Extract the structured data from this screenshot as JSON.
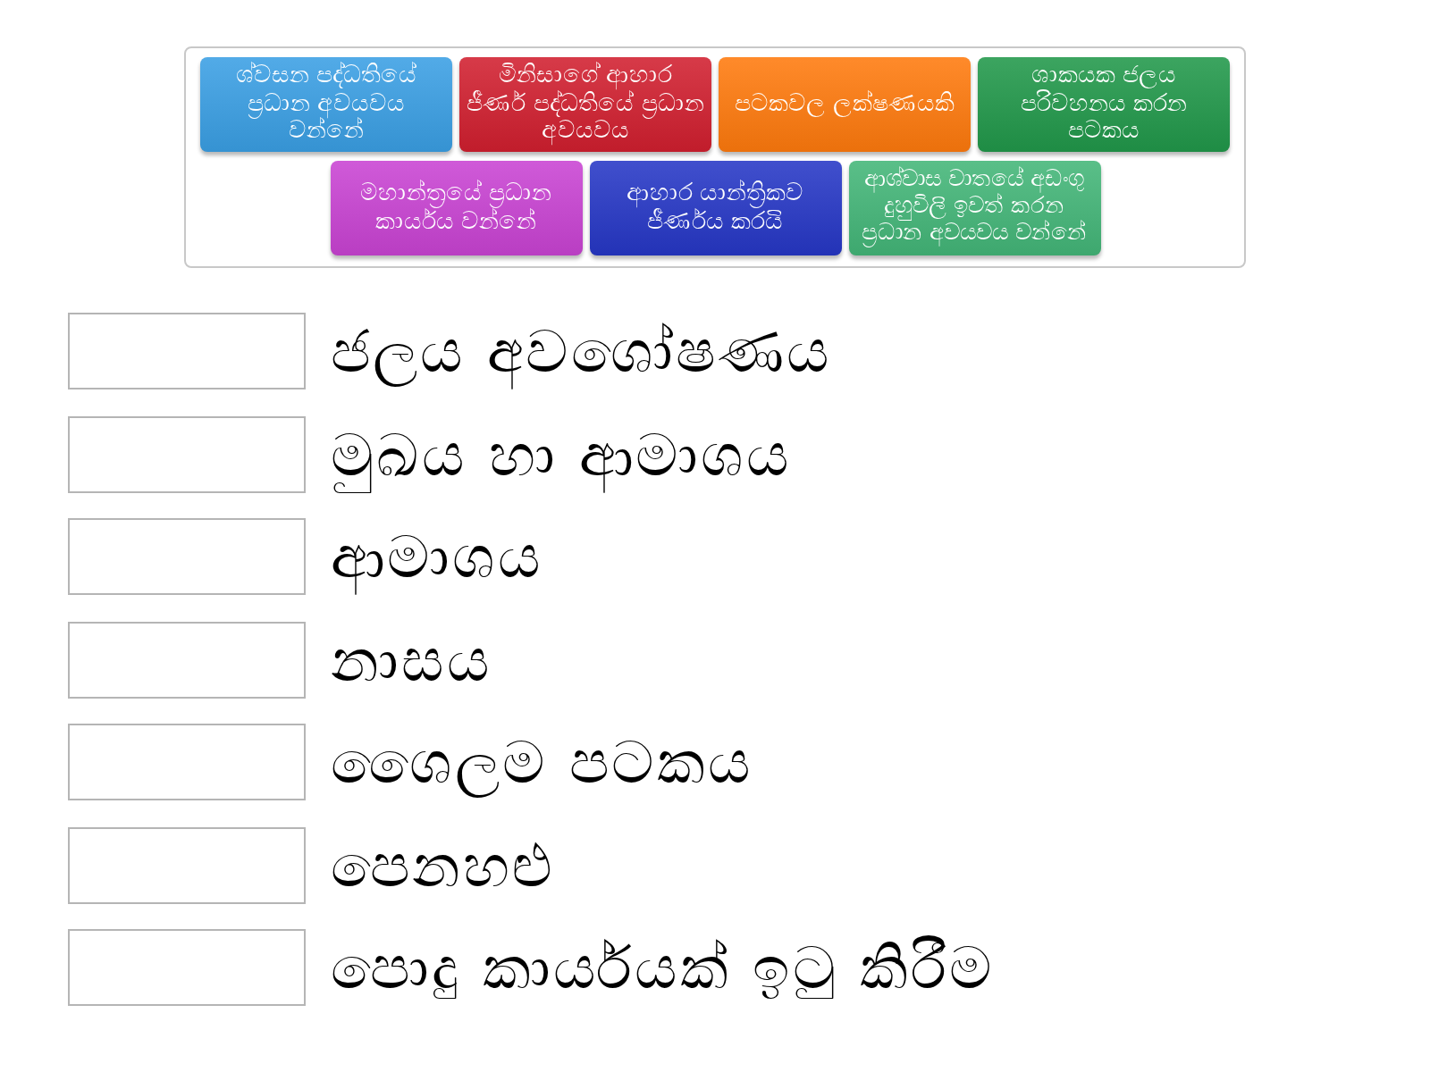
{
  "tiles": [
    {
      "text": "ශ්වසන පද්ධතියේ ප්‍රධාන අවයවය වන්නේ",
      "color": "#3a9fe4"
    },
    {
      "text": "මිනිසාගේ ආහාර ජීර්ණ පද්ධතියේ ප්‍රධාන අවයවය",
      "color": "#d11f2f"
    },
    {
      "text": "පටකවල ලක්ෂණයකි",
      "color": "#ff7a0d"
    },
    {
      "text": "ශාකයක ජලය පරිවහනය කරන පටකය",
      "color": "#21984a"
    },
    {
      "text": "මහාන්ත්‍රයේ ප්‍රධාන කාර්යය වන්නේ",
      "color": "#c943d3"
    },
    {
      "text": "ආහාර යාන්ත්‍රිකව ජීර්ණය කරයි",
      "color": "#2637c6"
    },
    {
      "text": "ආශ්වාස වාතයේ අඩංගු දුහුවිලි ඉවත් කරන ප්‍රධාන අවයවය වන්නේ",
      "color": "#43b678"
    }
  ],
  "items": [
    {
      "text": "ජලය අවශෝෂණය"
    },
    {
      "text": "මුඛය හා ආමාශය"
    },
    {
      "text": "ආමාශය"
    },
    {
      "text": "නාසය"
    },
    {
      "text": "ශෛලම පටකය"
    },
    {
      "text": "පෙනහළු"
    },
    {
      "text": "පොදු කාර්යයක් ඉටු කිරීම"
    }
  ]
}
